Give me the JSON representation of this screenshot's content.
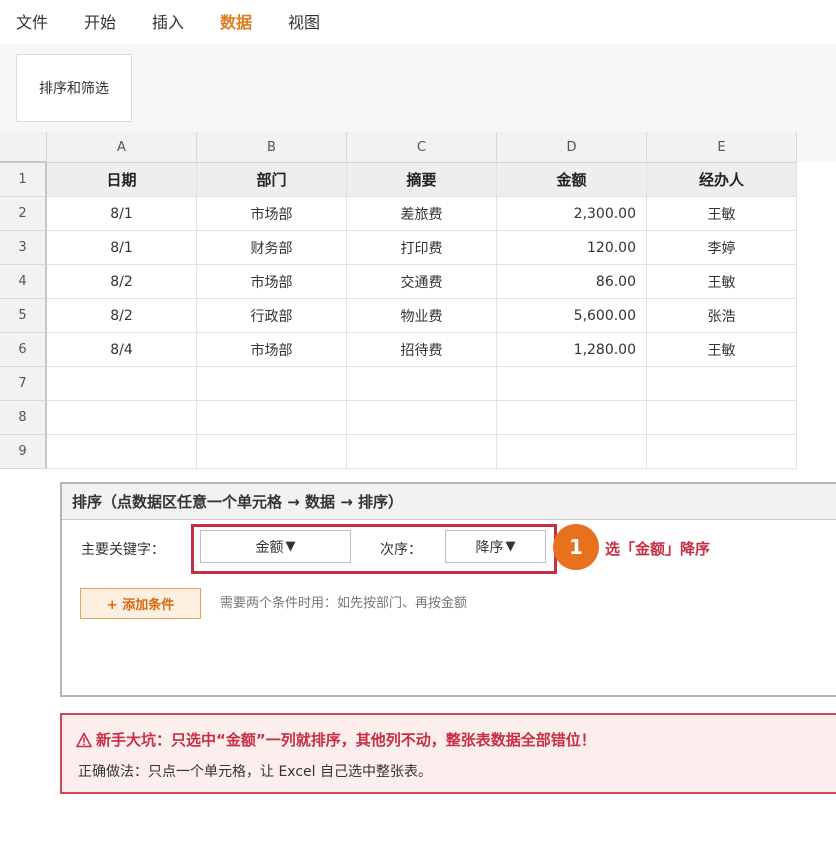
{
  "menu": {
    "items": [
      {
        "label": "文件",
        "active": false
      },
      {
        "label": "开始",
        "active": false
      },
      {
        "label": "插入",
        "active": false
      },
      {
        "label": "数据",
        "active": true
      },
      {
        "label": "视图",
        "active": false
      }
    ]
  },
  "ribbon": {
    "sort_filter_label": "排序和筛选"
  },
  "sheet": {
    "columns": [
      "A",
      "B",
      "C",
      "D",
      "E"
    ],
    "rows": [
      "1",
      "2",
      "3",
      "4",
      "5",
      "6",
      "7",
      "8",
      "9"
    ],
    "header_cells": [
      "日期",
      "部门",
      "摘要",
      "金额",
      "经办人"
    ],
    "data": [
      [
        "8/1",
        "市场部",
        "差旅费",
        "2,300.00",
        "王敏"
      ],
      [
        "8/1",
        "财务部",
        "打印费",
        "120.00",
        "李婷"
      ],
      [
        "8/2",
        "市场部",
        "交通费",
        "86.00",
        "王敏"
      ],
      [
        "8/2",
        "行政部",
        "物业费",
        "5,600.00",
        "张浩"
      ],
      [
        "8/4",
        "市场部",
        "招待费",
        "1,280.00",
        "王敏"
      ]
    ],
    "empty_rows": 3
  },
  "sort_dialog": {
    "title": "排序（点数据区任意一个单元格 → 数据 → 排序）",
    "primary_key_label": "主要关键字：",
    "primary_key_value": "金额",
    "order_label": "次序：",
    "order_value": "降序",
    "caret": "▼",
    "step_number": "1",
    "step_text": "选「金额」降序",
    "add_condition_label": "+ 添加条件",
    "hint": "需要两个条件时用：如先按部门、再按金额"
  },
  "warning": {
    "title": "新手大坑：只选中“金额”一列就排序，其他列不动，整张表数据全部错位！",
    "body": "正确做法：只点一个单元格，让 Excel 自己选中整张表。"
  },
  "colors": {
    "accent": "#e07c20",
    "step_badge": "#e8711e",
    "highlight": "#c62f45",
    "warning_bg": "#fdeeee"
  }
}
